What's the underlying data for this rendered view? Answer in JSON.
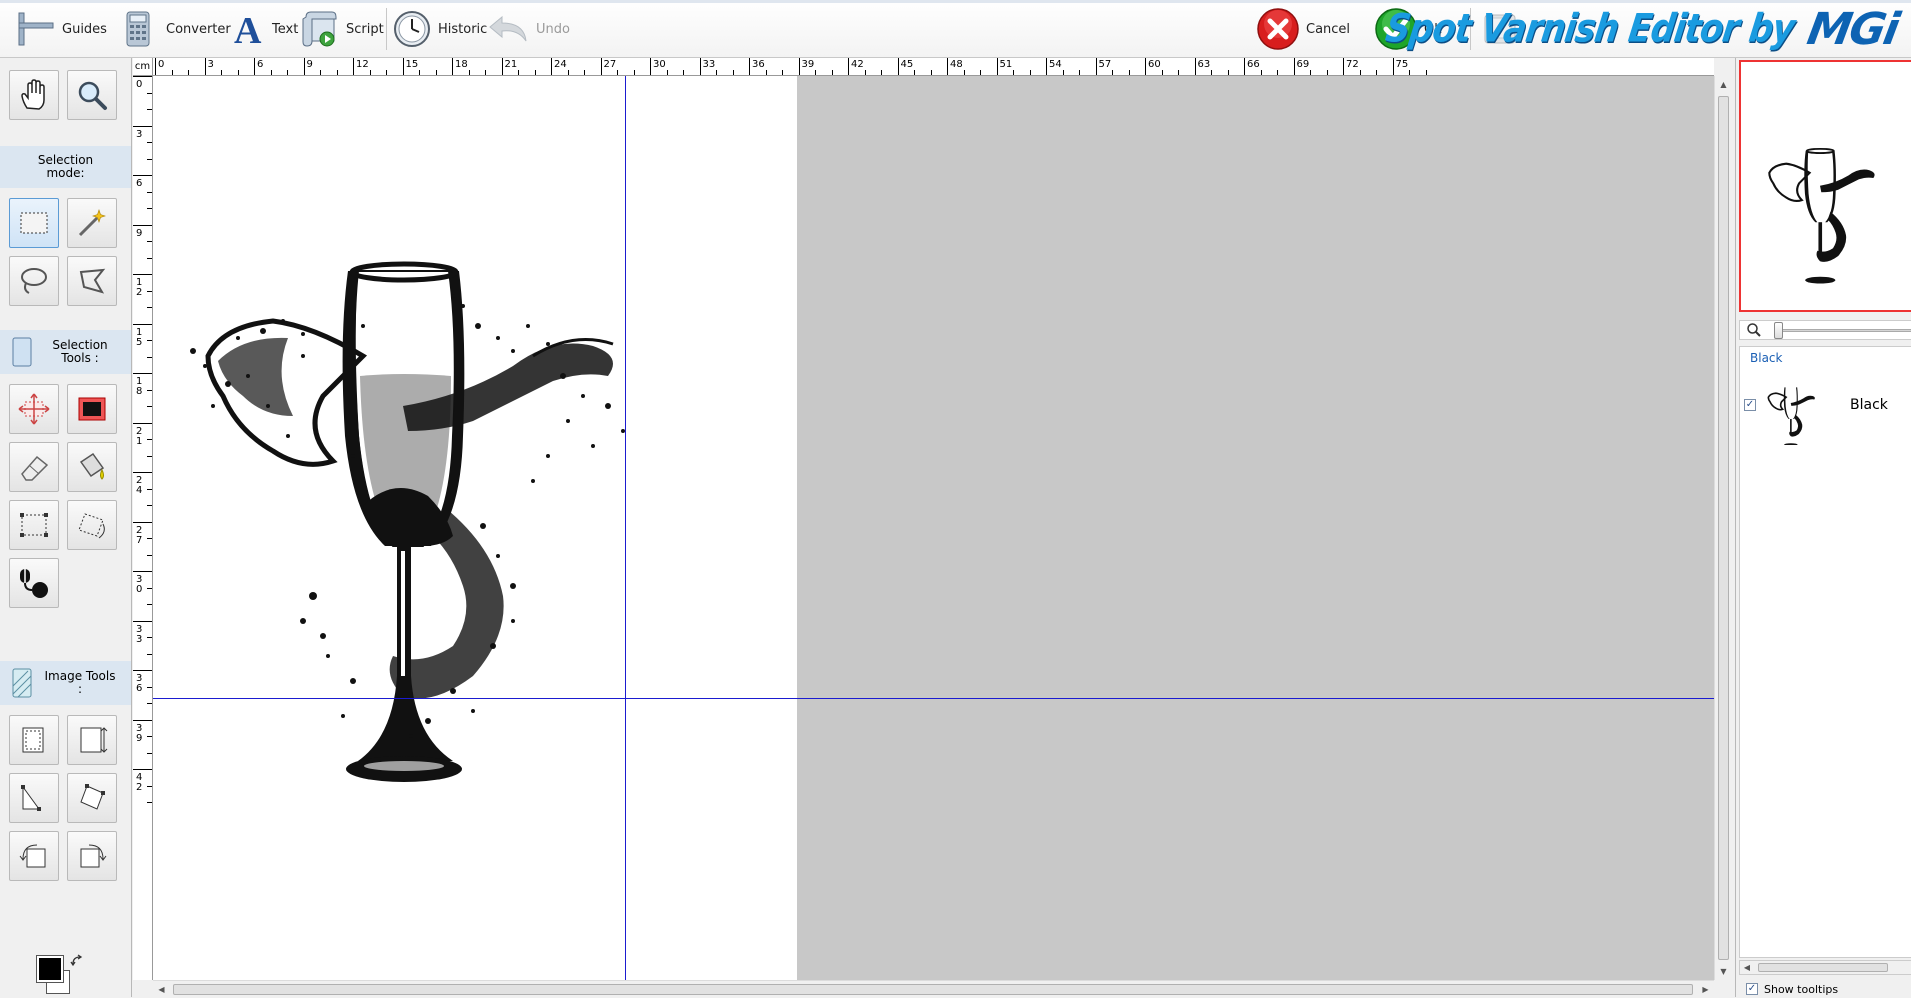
{
  "toolbar": {
    "guides": "Guides",
    "converter": "Converter",
    "text": "Text",
    "script": "Script",
    "historic": "Historic",
    "undo": "Undo",
    "cancel": "Cancel",
    "ok": "Ok"
  },
  "brand": {
    "title": "Spot Varnish Editor by",
    "logo": "MGi"
  },
  "left_panel": {
    "selection_mode": "Selection mode:",
    "selection_tools": "Selection Tools :",
    "image_tools": "Image Tools :",
    "foreground_color": "#000000",
    "background_color": "#ffffff"
  },
  "ruler": {
    "unit": "cm",
    "h_labels": [
      "0",
      "3",
      "6",
      "9",
      "12",
      "15",
      "18",
      "21",
      "24",
      "27",
      "30",
      "33",
      "36",
      "39",
      "42",
      "45",
      "48",
      "51",
      "54",
      "57",
      "60",
      "63",
      "66",
      "69",
      "72",
      "75"
    ],
    "v_labels": [
      "0",
      "3",
      "6",
      "9",
      "12",
      "15",
      "18",
      "21",
      "24",
      "27",
      "30",
      "33",
      "36",
      "39",
      "42"
    ]
  },
  "layers": {
    "header": "Black",
    "items": [
      {
        "name": "Black",
        "checked": true
      }
    ]
  },
  "options": {
    "show_tooltips": "Show tooltips",
    "show_tooltips_checked": true
  },
  "colors": {
    "guide": "#1b1bd0",
    "page": "#ffffff",
    "workspace": "#c8c8c8",
    "accent": "#1a9be0"
  }
}
